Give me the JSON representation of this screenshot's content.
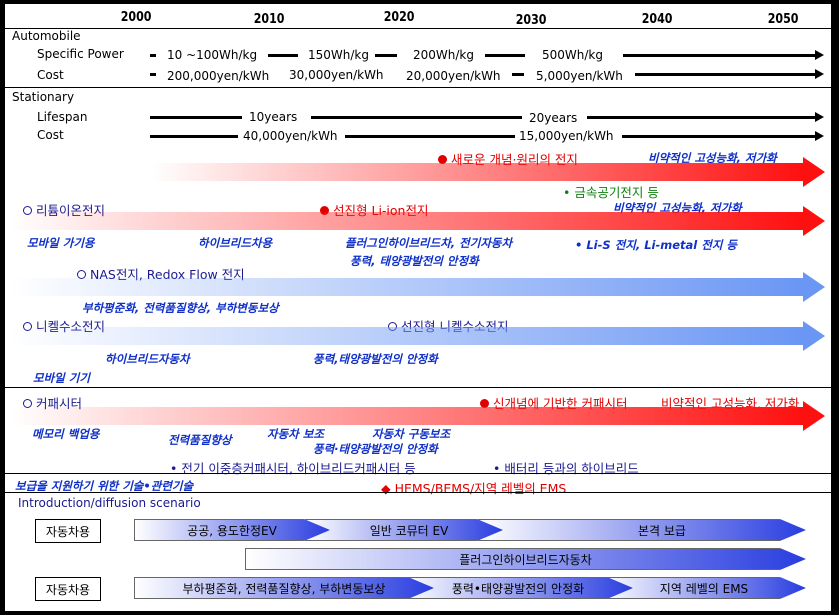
{
  "years": [
    "2000",
    "2010",
    "2020",
    "2030",
    "2040",
    "2050"
  ],
  "automobile": {
    "title": "Automobile",
    "specific_power": {
      "label": "Specific Power",
      "values": [
        "10 ~100Wh/kg",
        "150Wh/kg",
        "200Wh/kg",
        "500Wh/kg"
      ]
    },
    "cost": {
      "label": "Cost",
      "values": [
        "200,000yen/kWh",
        "30,000yen/kWh",
        "20,000yen/kWh",
        "5,000yen/kWh"
      ]
    }
  },
  "stationary": {
    "title": "Stationary",
    "lifespan": {
      "label": "Lifespan",
      "values": [
        "10years",
        "20years"
      ]
    },
    "cost": {
      "label": "Cost",
      "values": [
        "40,000yen/kWh",
        "15,000yen/kWh"
      ]
    }
  },
  "tech": {
    "new_concept": "새로운 개념·원리의 전지",
    "new_concept_goal": "비약적인 고성능화, 저가화",
    "metal_air": "금속공기전지 등",
    "li_ion": "리튬이온전지",
    "adv_li_ion": "선진형 Li-ion전지",
    "li_goal": "비약적인 고성능화, 저가화",
    "li_apps": [
      "모바일 가기용",
      "하이브리드차용",
      "플러그인하이브리드차, 전기자동차",
      "풍력, 태양광발전의 안정화"
    ],
    "li_s": "Li-S 전지, Li-metal 전지 등",
    "nas": "NAS전지, Redox Flow 전지",
    "nas_app": "부하평준화, 전력품질향상, 부하변동보상",
    "nimh": "니켈수소전지",
    "adv_nimh": "선진형 니켈수소전지",
    "nimh_apps": [
      "하이브리드자동차",
      "풍력,태양광발전의 안정화",
      "모바일 기기"
    ],
    "cap": "커패시터",
    "new_cap": "신개념에 기반한 커패시터",
    "cap_goal": "비약적인 고성능화, 저가화",
    "cap_apps": [
      "메모리 백업용",
      "전력품질향상",
      "자동차 보조",
      "자동차 구동보조",
      "풍력·태양광발전의 안정화"
    ],
    "cap_types": "전기 이중층커패시터, 하이브리드커패시터 등",
    "cap_hybrid": "배터리 등과의 하이브리드"
  },
  "support": {
    "label": "보급을 지원하기 위한 기술•관련기술",
    "ems": "HEMS/BEMS/지역 레벨의 EMS"
  },
  "scenario": {
    "title": "Introduction/diffusion scenario",
    "row1_label": "자동차용",
    "row1": [
      "공공, 용도한정EV",
      "일반 코뮤터 EV",
      "본격 보급"
    ],
    "row2": "플러그인하이브리드자동차",
    "row3_label": "자동차용",
    "row3": [
      "부하평준화, 전력품질향상, 부하변동보상",
      "풍력•태양광발전의 안정화",
      "지역 레벨의 EMS"
    ]
  },
  "colors": {
    "red": "#ff1010",
    "blue": "#6a96f4",
    "text_blue": "#1030c8",
    "green": "#108010"
  }
}
